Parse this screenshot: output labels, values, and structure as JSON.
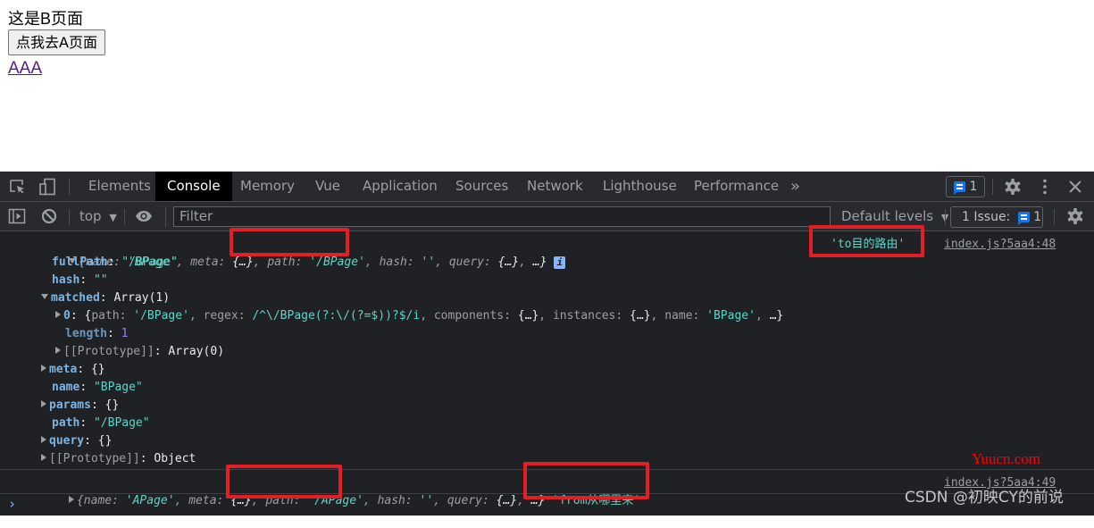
{
  "page": {
    "title": "这是B页面",
    "button_label": "点我去A页面",
    "link_text": "AAA"
  },
  "devtools": {
    "tabs": [
      {
        "label": "Elements"
      },
      {
        "label": "Console"
      },
      {
        "label": "Memory"
      },
      {
        "label": "Vue"
      },
      {
        "label": "Application"
      },
      {
        "label": "Sources"
      },
      {
        "label": "Network"
      },
      {
        "label": "Lighthouse"
      },
      {
        "label": "Performance"
      }
    ],
    "active_tab": "Console",
    "more_tabs": "»",
    "message_count": "1",
    "toolbar": {
      "context": "top",
      "filter_placeholder": "Filter",
      "levels": "Default levels",
      "issues_label": "1 Issue:",
      "issues_count": "1"
    }
  },
  "console": {
    "entry1": {
      "summary": {
        "open": "{",
        "k_name": "name",
        "v_name": "'BPage'",
        "k_meta": "meta",
        "v_meta": "{…}",
        "k_path": "path",
        "v_path": "'/BPage'",
        "k_hash": "hash",
        "v_hash": "''",
        "k_query": "query",
        "v_query": "{…}",
        "rest": "…}"
      },
      "info_icon": "i",
      "label": "'to目的路由'",
      "source": "index.js?5aa4:48",
      "props": {
        "fullPath_k": "fullPath",
        "fullPath_v": "\"/BPage\"",
        "hash_k": "hash",
        "hash_v": "\"\"",
        "matched_k": "matched",
        "matched_v": "Array(1)",
        "m0_k": "0",
        "m0_path_k": "path",
        "m0_path_v": "'/BPage'",
        "m0_regex_k": "regex",
        "m0_regex_v": "/^\\/BPage(?:\\/(?=$))?$/i",
        "m0_components_k": "components",
        "m0_components_v": "{…}",
        "m0_instances_k": "instances",
        "m0_instances_v": "{…}",
        "m0_name_k": "name",
        "m0_name_v": "'BPage'",
        "m0_rest": "…}",
        "length_k": "length",
        "length_v": "1",
        "arr_proto_k": "[[Prototype]]",
        "arr_proto_v": "Array(0)",
        "meta_k": "meta",
        "meta_v": "{}",
        "name_k": "name",
        "name_v": "\"BPage\"",
        "params_k": "params",
        "params_v": "{}",
        "path_k": "path",
        "path_v": "\"/BPage\"",
        "query_k": "query",
        "query_v": "{}",
        "proto_k": "[[Prototype]]",
        "proto_v": "Object"
      }
    },
    "entry2": {
      "summary": {
        "k_name": "name",
        "v_name": "'APage'",
        "k_meta": "meta",
        "v_meta": "{…}",
        "k_path": "path",
        "v_path": "'/APage'",
        "k_hash": "hash",
        "v_hash": "''",
        "k_query": "query",
        "v_query": "{…}",
        "rest": "…}"
      },
      "label": "'from从哪里来'",
      "source": "index.js?5aa4:49"
    },
    "prompt": "›"
  },
  "watermarks": {
    "site": "Yuucn.com",
    "author": "CSDN @初映CY的前说"
  },
  "colors": {
    "highlight_box": "#e41e25",
    "string": "#5cd5c8",
    "key": "#7fb4e0",
    "number": "#9980ff",
    "accent": "#1a73e8"
  }
}
